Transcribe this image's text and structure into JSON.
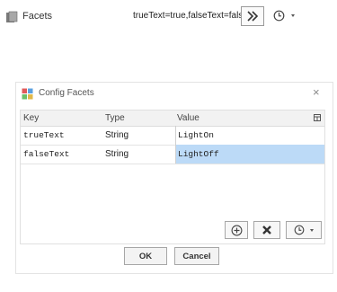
{
  "property": {
    "label": "Facets",
    "value": "trueText=true,falseText=false",
    "icon": "facets-icon",
    "expand_icon": "double-chevron-right-icon",
    "history_icon": "clock-icon"
  },
  "dialog": {
    "title": "Config Facets",
    "icon": "config-facets-icon",
    "close_label": "×",
    "table": {
      "headers": [
        "Key",
        "Type",
        "Value"
      ],
      "rows": [
        {
          "key": "trueText",
          "type": "String",
          "value": "LightOn",
          "selected": false
        },
        {
          "key": "falseText",
          "type": "String",
          "value": "LightOff",
          "selected": true
        }
      ]
    },
    "actions": {
      "add_icon": "add-circle-icon",
      "delete_icon": "delete-x-icon",
      "history_icon": "clock-icon"
    },
    "ok_label": "OK",
    "cancel_label": "Cancel"
  },
  "colors": {
    "selection": "#bcdaf7",
    "delete_icon": "#333333"
  }
}
